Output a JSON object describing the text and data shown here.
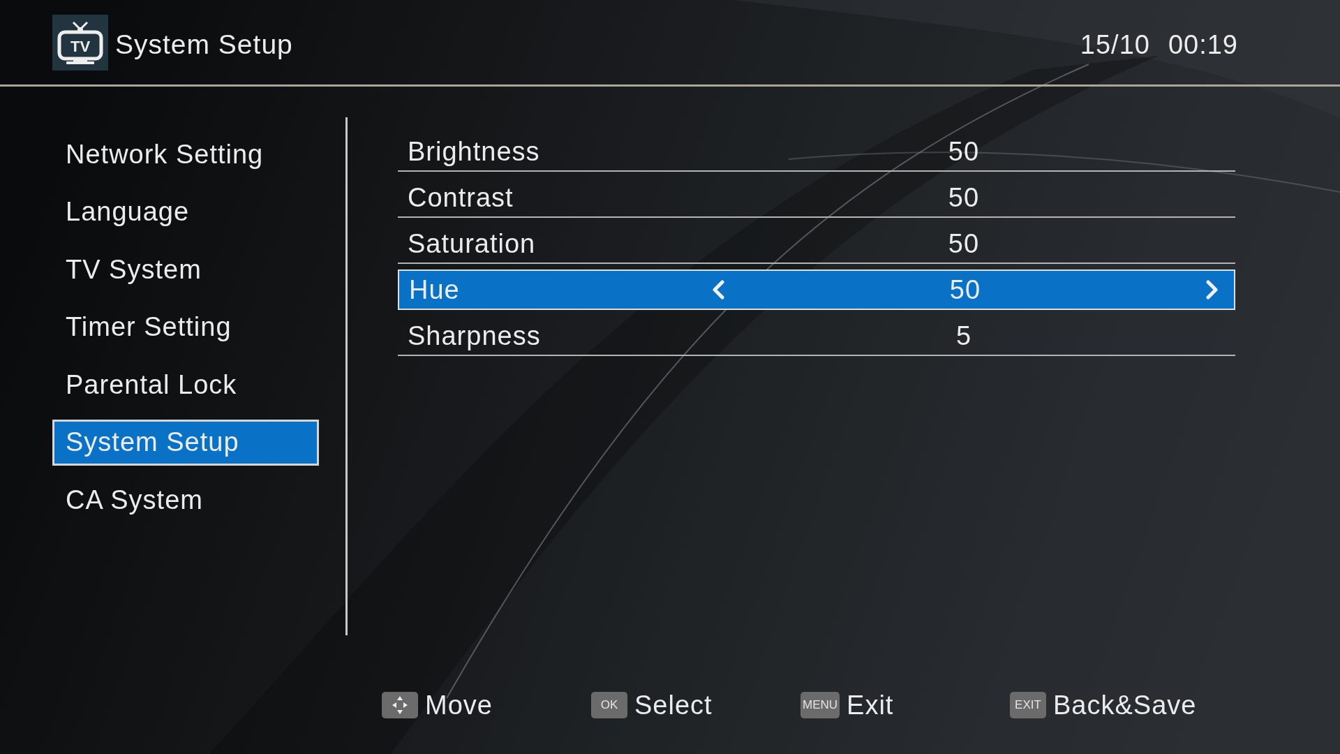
{
  "header": {
    "logo_text": "TV",
    "title": "System Setup",
    "date": "15/10",
    "time": "00:19"
  },
  "menu": {
    "items": [
      {
        "label": "Network Setting",
        "selected": false
      },
      {
        "label": "Language",
        "selected": false
      },
      {
        "label": "TV System",
        "selected": false
      },
      {
        "label": "Timer Setting",
        "selected": false
      },
      {
        "label": "Parental Lock",
        "selected": false
      },
      {
        "label": "System Setup",
        "selected": true
      },
      {
        "label": "CA System",
        "selected": false
      }
    ]
  },
  "settings": {
    "items": [
      {
        "label": "Brightness",
        "value": "50",
        "selected": false
      },
      {
        "label": "Contrast",
        "value": "50",
        "selected": false
      },
      {
        "label": "Saturation",
        "value": "50",
        "selected": false
      },
      {
        "label": "Hue",
        "value": "50",
        "selected": true
      },
      {
        "label": "Sharpness",
        "value": "5",
        "selected": false
      }
    ]
  },
  "footer": {
    "hints": [
      {
        "kind": "dpad",
        "label": "Move"
      },
      {
        "kind": "key",
        "key": "OK",
        "label": "Select"
      },
      {
        "kind": "key",
        "key": "MENU",
        "label": "Exit"
      },
      {
        "kind": "key",
        "key": "EXIT",
        "label": "Back&Save"
      }
    ]
  }
}
